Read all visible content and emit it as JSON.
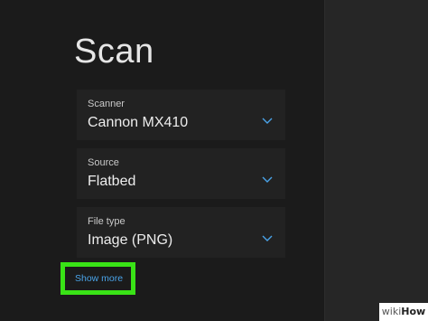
{
  "page": {
    "title": "Scan"
  },
  "fields": {
    "scanner": {
      "label": "Scanner",
      "value": "Cannon MX410"
    },
    "source": {
      "label": "Source",
      "value": "Flatbed"
    },
    "file_type": {
      "label": "File type",
      "value": "Image (PNG)"
    }
  },
  "show_more": {
    "label": "Show more"
  },
  "watermark": {
    "wiki": "wiki",
    "how": "How"
  },
  "colors": {
    "highlight": "#39e316",
    "link": "#4aa3e8",
    "chevron": "#4aa3e8"
  }
}
